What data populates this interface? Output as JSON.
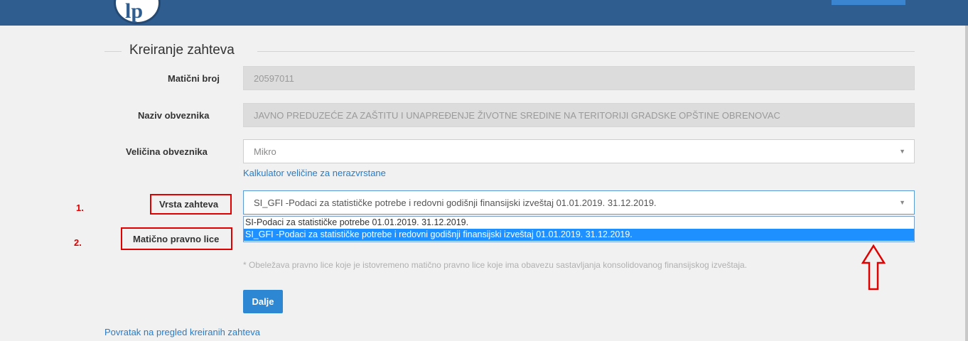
{
  "header": {
    "logo_text": "lp"
  },
  "form": {
    "title": "Kreiranje zahteva",
    "maticni_broj": {
      "label": "Matični broj",
      "value": "20597011"
    },
    "naziv": {
      "label": "Naziv obveznika",
      "value": "JAVNO PREDUZEĆE ZA ZAŠTITU I UNAPREĐENJE ŽIVOTNE SREDINE NA TERITORIJI GRADSKE OPŠTINE OBRENOVAC"
    },
    "velicina": {
      "label": "Veličina obveznika",
      "value": "Mikro",
      "calculator_link": "Kalkulator veličine za nerazvrstane"
    },
    "vrsta": {
      "label": "Vrsta zahteva",
      "value": "SI_GFI -Podaci za statističke potrebe i redovni godišnji finansijski izveštaj 01.01.2019. 31.12.2019.",
      "options": [
        "SI-Podaci za statističke potrebe 01.01.2019. 31.12.2019.",
        "SI_GFI -Podaci za statističke potrebe i redovni godišnji finansijski izveštaj 01.01.2019. 31.12.2019."
      ]
    },
    "maticno_lice": {
      "label": "Matično pravno lice"
    },
    "note": "* Obeležava pravno lice koje je istovremeno matično pravno lice koje ima obavezu sastavljanja konsolidovanog finansijskog izveštaja.",
    "submit_label": "Dalje",
    "back_link": "Povratak na pregled kreiranih zahteva"
  },
  "annotations": {
    "marker_1": "1.",
    "marker_2": "2.",
    "color": "#e00000"
  },
  "colors": {
    "header": "#2f5d90",
    "accent": "#2d87d3",
    "selected": "#1e90ff"
  }
}
